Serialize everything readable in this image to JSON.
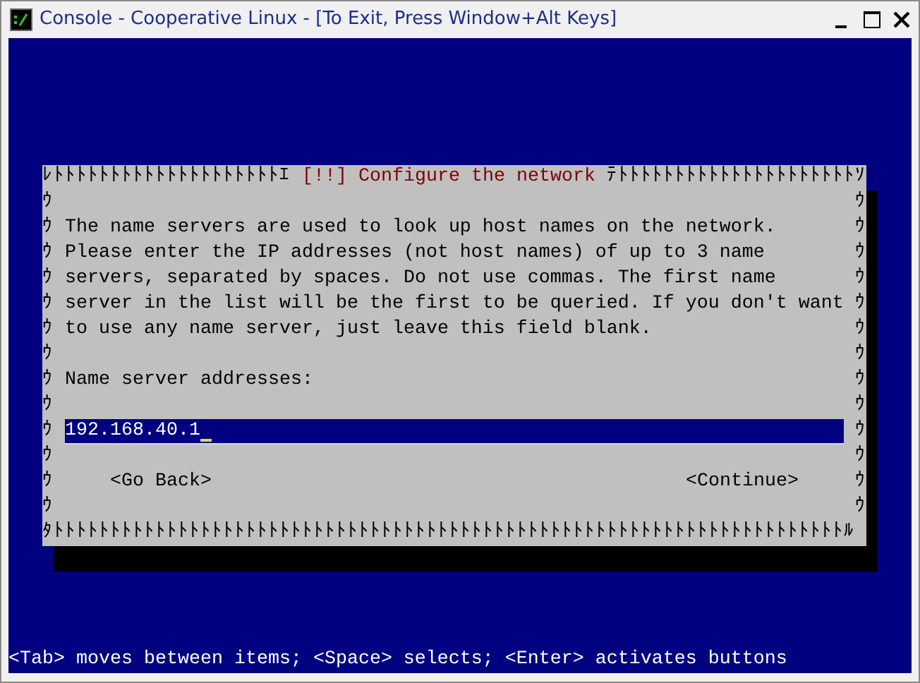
{
  "window": {
    "title": "Console - Cooperative Linux - [To Exit, Press Window+Alt Keys]"
  },
  "dialog": {
    "border_top_left": "ﾚﾄﾄﾄﾄﾄﾄﾄﾄﾄﾄﾄﾄﾄﾄﾄﾄﾄﾄﾄﾄｴ",
    "title": "[!!] Configure the network",
    "border_top_right": "ﾃﾄﾄﾄﾄﾄﾄﾄﾄﾄﾄﾄﾄﾄﾄﾄﾄﾄﾄﾄﾄﾄｿ",
    "border_left": [
      "ｳ",
      "ｳ",
      "ｳ",
      "ｳ",
      "ｳ",
      "ｳ",
      "ｳ",
      "ｳ",
      "ｳ",
      "ｳ",
      "ｳ",
      "ｳ",
      "ｳ"
    ],
    "border_right": [
      "ｳ",
      "ｳ",
      "ｳ",
      "ｳ",
      "ｳ",
      "ｳ",
      "ｳ",
      "ｳ",
      "ｳ",
      "ｳ",
      "ｳ",
      "ｳ",
      "ｳ"
    ],
    "border_bottom": "ﾀﾄﾄﾄﾄﾄﾄﾄﾄﾄﾄﾄﾄﾄﾄﾄﾄﾄﾄﾄﾄﾄﾄﾄﾄﾄﾄﾄﾄﾄﾄﾄﾄﾄﾄﾄﾄﾄﾄﾄﾄﾄﾄﾄﾄﾄﾄﾄﾄﾄﾄﾄﾄﾄﾄﾄﾄﾄﾄﾄﾄﾄﾄﾄﾄﾄﾄﾄﾄﾄﾄﾙ",
    "paragraph_lines": [
      "The name servers are used to look up host names on the network.",
      "Please enter the IP addresses (not host names) of up to 3 name",
      "servers, separated by spaces. Do not use commas. The first name",
      "server in the list will be the first to be queried. If you don't want",
      "to use any name server, just leave this field blank."
    ],
    "field_label": "Name server addresses:",
    "field": {
      "value": "192.168.40.1"
    },
    "buttons": [
      {
        "label": "<Go Back>"
      },
      {
        "label": "<Continue>"
      }
    ]
  },
  "status_line": "<Tab> moves between items; <Space> selects; <Enter> activates buttons"
}
